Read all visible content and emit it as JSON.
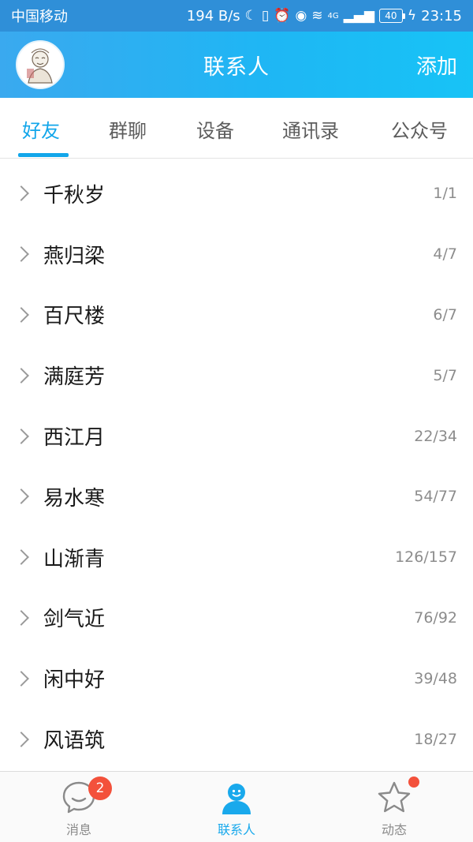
{
  "status_bar": {
    "carrier": "中国移动",
    "speed": "194 B/s",
    "network": "4G",
    "battery": "40",
    "time": "23:15"
  },
  "header": {
    "title": "联系人",
    "add_label": "添加"
  },
  "tabs": [
    {
      "label": "好友",
      "active": true
    },
    {
      "label": "群聊",
      "active": false
    },
    {
      "label": "设备",
      "active": false
    },
    {
      "label": "通讯录",
      "active": false
    },
    {
      "label": "公众号",
      "active": false
    }
  ],
  "groups": [
    {
      "name": "千秋岁",
      "count": "1/1"
    },
    {
      "name": "燕归梁",
      "count": "4/7"
    },
    {
      "name": "百尺楼",
      "count": "6/7"
    },
    {
      "name": "满庭芳",
      "count": "5/7"
    },
    {
      "name": "西江月",
      "count": "22/34"
    },
    {
      "name": "易水寒",
      "count": "54/77"
    },
    {
      "name": "山渐青",
      "count": "126/157"
    },
    {
      "name": "剑气近",
      "count": "76/92"
    },
    {
      "name": "闲中好",
      "count": "39/48"
    },
    {
      "name": "风语筑",
      "count": "18/27"
    }
  ],
  "bottom_nav": {
    "items": [
      {
        "label": "消息",
        "icon": "chat-bubble-icon",
        "badge": "2"
      },
      {
        "label": "联系人",
        "icon": "contact-person-icon",
        "active": true
      },
      {
        "label": "动态",
        "icon": "star-icon",
        "has_dot": true
      }
    ]
  },
  "colors": {
    "accent": "#12a6ea",
    "header_gradient_start": "#3aa9ef",
    "header_gradient_end": "#17c3f6",
    "badge": "#f3513b"
  }
}
